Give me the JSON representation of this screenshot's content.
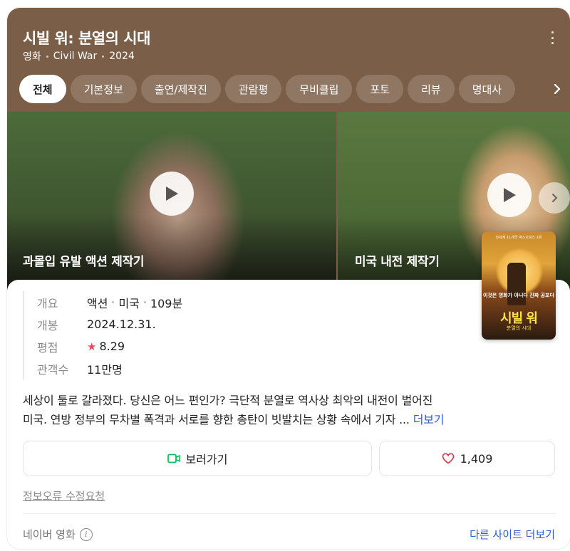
{
  "header": {
    "title": "시빌 워: 분열의 시대",
    "meta": [
      "영화",
      "Civil War",
      "2024"
    ]
  },
  "tabs": [
    "전체",
    "기본정보",
    "출연/제작진",
    "관람평",
    "무비클립",
    "포토",
    "리뷰",
    "명대사"
  ],
  "videos": [
    {
      "caption": "과몰입 유발 액션 제작기"
    },
    {
      "caption": "미국 내전 제작기"
    }
  ],
  "facts": {
    "overview_label": "개요",
    "overview_values": [
      "액션",
      "미국",
      "109분"
    ],
    "release_label": "개봉",
    "release_value": "2024.12.31.",
    "rating_label": "평점",
    "rating_value": "8.29",
    "audience_label": "관객수",
    "audience_value": "11만명"
  },
  "poster": {
    "tagline": "전세계 11개국 박스오피스 1위",
    "middle": "이것은 영화가 아니다 진짜 공포다",
    "title": "시빌 워",
    "subtitle": "분열의 시대"
  },
  "synopsis": {
    "line1": "세상이 둘로 갈라졌다. 당신은 어느 편인가? 극단적 분열로 역사상 최악의 내전이 벌어진",
    "line2": "미국. 연방 정부의 무차별 폭격과 서로를 향한 총탄이 빗발치는 상황 속에서 기자 ...",
    "more": "더보기"
  },
  "actions": {
    "watch_label": "보러가기",
    "like_count": "1,409"
  },
  "footer": {
    "report": "정보오류 수정요청",
    "source": "네이버 영화",
    "other_sites": "다른 사이트 더보기"
  },
  "colors": {
    "hero_bg": "#7a5e47",
    "link_blue": "#2d5bd3",
    "star_red": "#ec4a5a",
    "watch_green": "#03c75a",
    "heart_red": "#e0344e"
  }
}
